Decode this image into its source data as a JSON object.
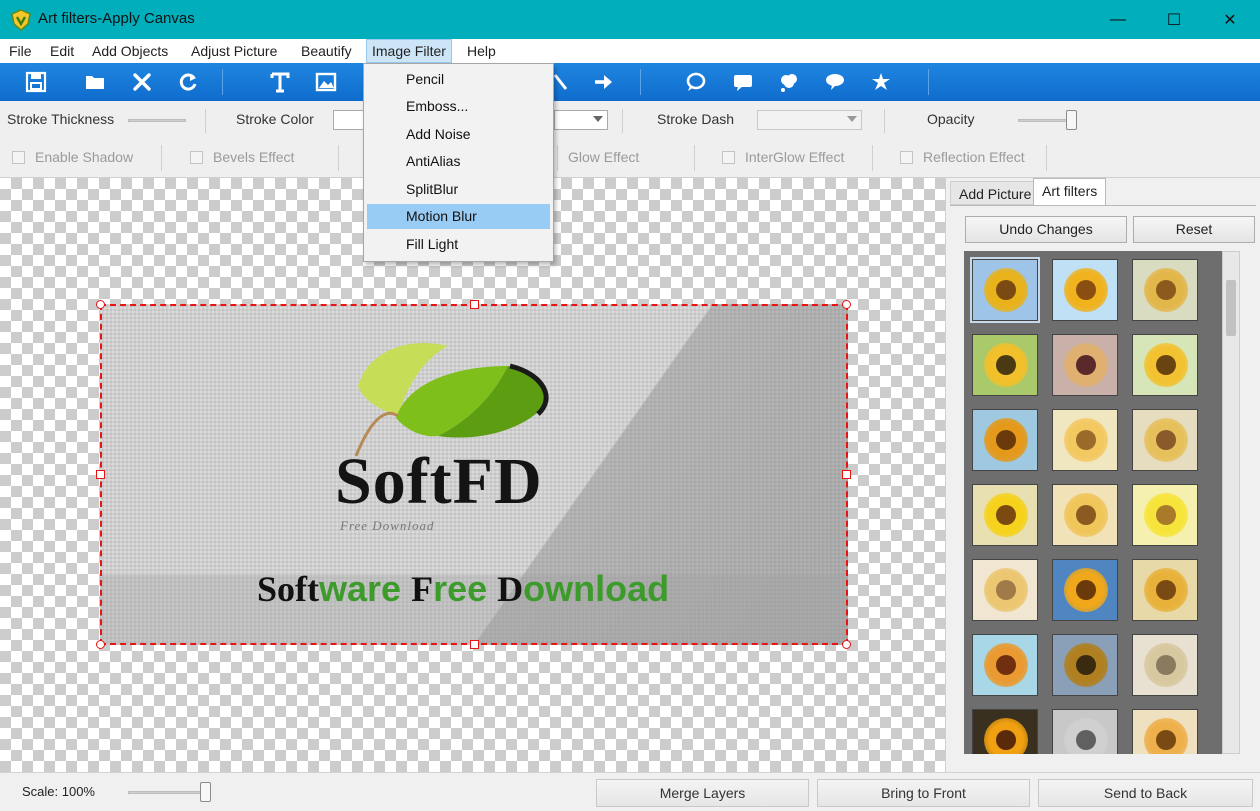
{
  "window": {
    "title": "Art filters-Apply Canvas",
    "controls": {
      "minimize": "—",
      "maximize": "☐",
      "close": "✕"
    }
  },
  "menu": [
    "File",
    "Edit",
    "Add Objects",
    "Adjust Picture",
    "Beautify",
    "Image Filter",
    "Help"
  ],
  "menu_active": "Image Filter",
  "toolbar_icons": [
    "save-icon",
    "open-folder-icon",
    "delete-icon",
    "refresh-icon",
    "text-icon",
    "image-icon",
    "line-icon",
    "arrow-right-icon",
    "speech-bubble-icon",
    "rect-bubble-icon",
    "cloud-bubble-icon",
    "round-bubble-icon",
    "star-shape-icon"
  ],
  "props": {
    "stroke_thickness": "Stroke Thickness",
    "stroke_color": "Stroke Color",
    "stroke_dash": "Stroke Dash",
    "opacity": "Opacity",
    "effects": [
      "Enable Shadow",
      "Bevels Effect",
      "Glow Effect",
      "InterGlow Effect",
      "Reflection Effect"
    ]
  },
  "dropdown": {
    "items": [
      "Pencil",
      "Emboss...",
      "Add Noise",
      "AntiAlias",
      "SplitBlur",
      "Motion Blur",
      "Fill Light"
    ],
    "highlighted": "Motion Blur"
  },
  "artwork": {
    "logo": "SoftFD",
    "logo_sub": "Free Download",
    "tagline_parts": [
      "Soft",
      "ware ",
      "F",
      "ree ",
      "D",
      "ownload"
    ]
  },
  "panel": {
    "tabs": [
      "Add Picture",
      "Art filters"
    ],
    "active_tab": "Art filters",
    "undo": "Undo Changes",
    "reset": "Reset"
  },
  "status": {
    "scale": "Scale: 100%",
    "merge": "Merge Layers",
    "bring_front": "Bring to Front",
    "send_back": "Send to Back"
  },
  "colors": {
    "titlebar": "#00aebc",
    "toolbar": "#1976d2",
    "selection": "#e81414",
    "highlight": "#99ccf5"
  }
}
